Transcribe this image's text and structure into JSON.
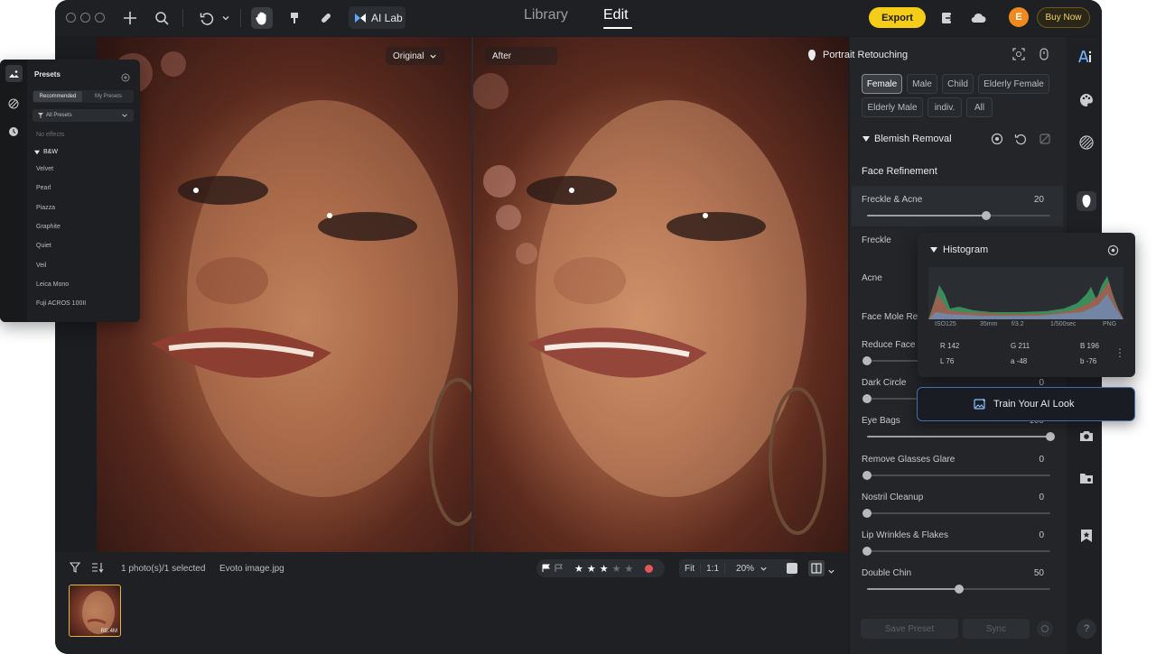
{
  "topbar": {
    "ailab_label": "AI Lab",
    "tab_library": "Library",
    "tab_edit": "Edit",
    "export_label": "Export",
    "avatar_letter": "E",
    "buy_now_label": "Buy Now"
  },
  "viewer": {
    "original_label": "Original",
    "after_label": "After"
  },
  "bottombar": {
    "selection_text": "1 photo(s)/1 selected",
    "filename": "Evoto image.jpg",
    "rating": 3,
    "rating_max": 5,
    "fit_label": "Fit",
    "one_to_one_label": "1:1",
    "zoom_value": "20%",
    "thumb_tag": "RE.4M"
  },
  "presets_panel": {
    "title": "Presets",
    "tab_recommended": "Recommended",
    "tab_my_presets": "My Presets",
    "dropdown": "All Presets",
    "no_effects": "No effects",
    "group": "B&W",
    "items": [
      "Velvet",
      "Pearl",
      "Piazza",
      "Graphite",
      "Quiet",
      "Veil",
      "Leica Mono",
      "Fuji ACROS 100II"
    ]
  },
  "right_panel": {
    "header": "Portrait Retouching",
    "chips": [
      "Female",
      "Male",
      "Child",
      "Elderly Female",
      "Elderly Male",
      "indiv.",
      "All"
    ],
    "active_chip": "Female",
    "section": "Blemish Removal",
    "subsection": "Face Refinement",
    "sliders": [
      {
        "label": "Freckle & Acne",
        "value": "20",
        "level": 0.65
      },
      {
        "label": "Freckle",
        "value": "",
        "level": 0.0
      },
      {
        "label": "Acne",
        "value": "",
        "level": 0.0
      },
      {
        "label": "Face Mole Re",
        "value": "",
        "level": 0.0
      },
      {
        "label": "Reduce Face",
        "value": "",
        "level": 0.0
      },
      {
        "label": "Dark Circle",
        "value": "0",
        "level": 0.0
      },
      {
        "label": "Eye Bags",
        "value": "100",
        "level": 1.0
      },
      {
        "label": "Remove Glasses Glare",
        "value": "0",
        "level": 0.0
      },
      {
        "label": "Nostril Cleanup",
        "value": "0",
        "level": 0.0
      },
      {
        "label": "Lip Wrinkles & Flakes",
        "value": "0",
        "level": 0.0
      },
      {
        "label": "Double Chin",
        "value": "50",
        "level": 0.5
      }
    ],
    "save_preset_label": "Save Preset",
    "sync_label": "Sync"
  },
  "histogram": {
    "title": "Histogram",
    "meta": [
      "ISO125",
      "35mm",
      "f/3.2",
      "1/500sec",
      "PNG"
    ],
    "rgb": [
      "R 142",
      "G 211",
      "B 196"
    ],
    "lab": [
      "L 76",
      "a -48",
      "b -76"
    ]
  },
  "train_button": {
    "label": "Train Your AI Look"
  },
  "colors": {
    "accent_yellow": "#f5cc17",
    "avatar_orange": "#f08a1e",
    "train_border": "#3e6fb0"
  }
}
